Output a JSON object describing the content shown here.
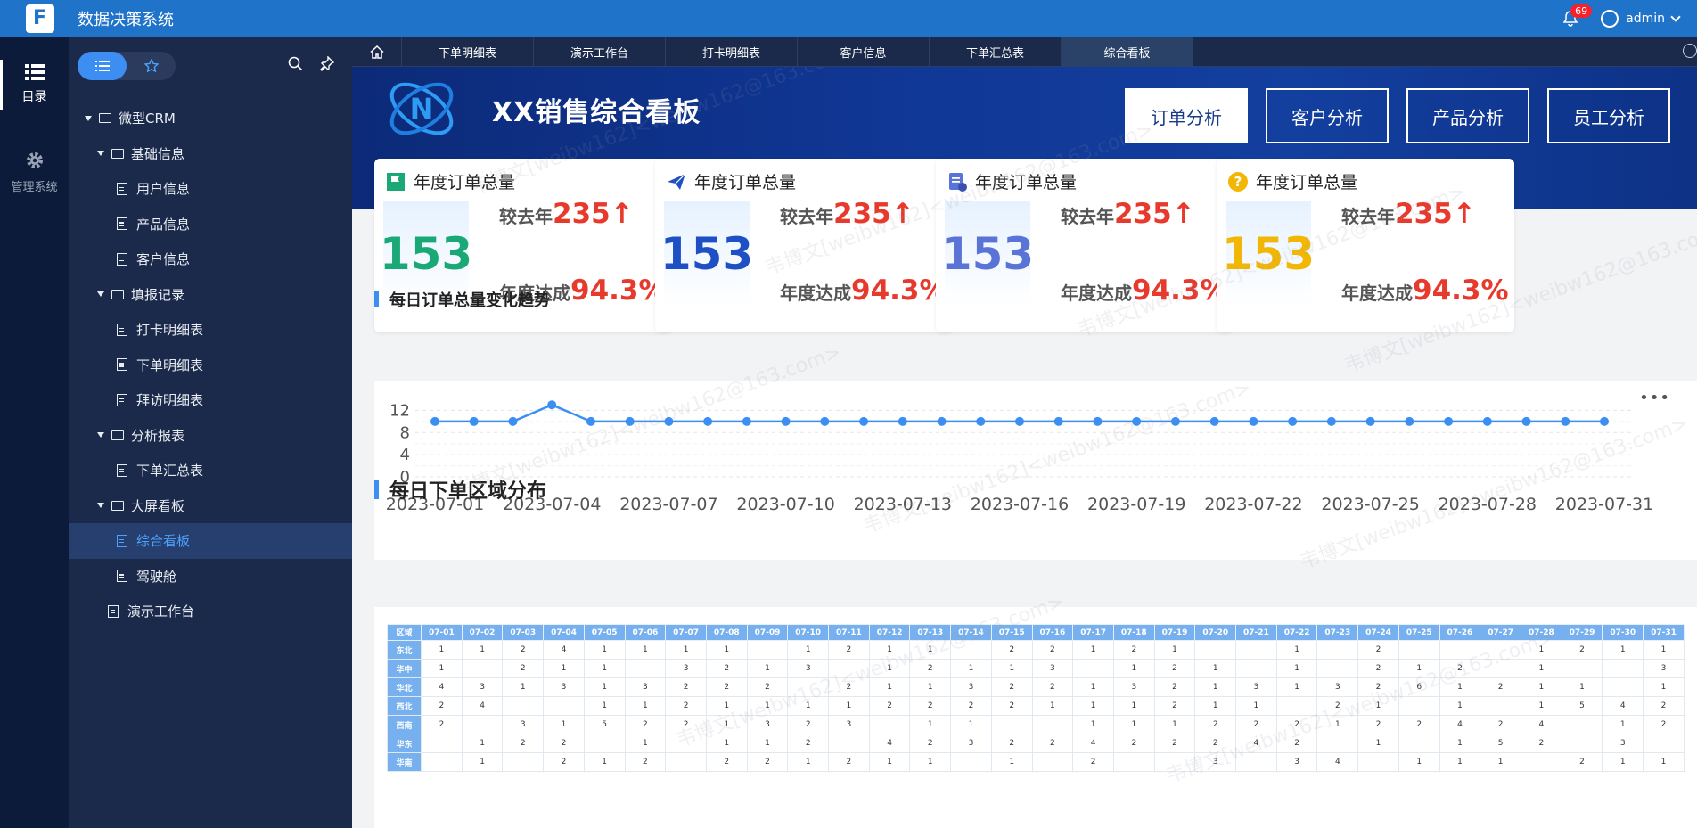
{
  "app": {
    "title": "数据决策系统",
    "logo_text": "F",
    "notifications": "69",
    "user": "admin"
  },
  "rail": [
    {
      "label": "目录",
      "icon": "list-icon"
    },
    {
      "label": "管理系统",
      "icon": "gear-icon"
    }
  ],
  "tree": [
    {
      "label": "微型CRM",
      "type": "folder",
      "level": 0
    },
    {
      "label": "基础信息",
      "type": "folder",
      "level": 1
    },
    {
      "label": "用户信息",
      "type": "doc",
      "level": 2
    },
    {
      "label": "产品信息",
      "type": "doc",
      "level": 2
    },
    {
      "label": "客户信息",
      "type": "doc",
      "level": 2
    },
    {
      "label": "填报记录",
      "type": "folder",
      "level": 1
    },
    {
      "label": "打卡明细表",
      "type": "doc",
      "level": 2
    },
    {
      "label": "下单明细表",
      "type": "doc",
      "level": 2
    },
    {
      "label": "拜访明细表",
      "type": "doc",
      "level": 2
    },
    {
      "label": "分析报表",
      "type": "folder",
      "level": 1
    },
    {
      "label": "下单汇总表",
      "type": "doc",
      "level": 2
    },
    {
      "label": "大屏看板",
      "type": "folder",
      "level": 1
    },
    {
      "label": "综合看板",
      "type": "doc",
      "level": 2,
      "selected": true
    },
    {
      "label": "驾驶舱",
      "type": "doc",
      "level": 2
    },
    {
      "label": "演示工作台",
      "type": "doc",
      "level": 1
    }
  ],
  "tabs": [
    "下单明细表",
    "演示工作台",
    "打卡明细表",
    "客户信息",
    "下单汇总表",
    "综合看板"
  ],
  "active_tab": "综合看板",
  "dashboard": {
    "title": "XX销售综合看板",
    "buttons": [
      "订单分析",
      "客户分析",
      "产品分析",
      "员工分析"
    ],
    "active_button": "订单分析",
    "cards": [
      {
        "title": "年度订单总量",
        "value": "153",
        "color": "#1aa876",
        "icon": "chart-flag-icon",
        "compare_label": "较去年",
        "compare_value": "235",
        "arrow": "↑",
        "rate_label": "年度达成",
        "rate_value": "94.3%"
      },
      {
        "title": "年度订单总量",
        "value": "153",
        "color": "#1e4fc4",
        "icon": "paper-plane-icon",
        "compare_label": "较去年",
        "compare_value": "235",
        "arrow": "↑",
        "rate_label": "年度达成",
        "rate_value": "94.3%"
      },
      {
        "title": "年度订单总量",
        "value": "153",
        "color": "#5a73d6",
        "icon": "document-badge-icon",
        "compare_label": "较去年",
        "compare_value": "235",
        "arrow": "↑",
        "rate_label": "年度达成",
        "rate_value": "94.3%"
      },
      {
        "title": "年度订单总量",
        "value": "153",
        "color": "#f2b705",
        "icon": "question-circle-icon",
        "compare_label": "较去年",
        "compare_value": "235",
        "arrow": "↑",
        "rate_label": "年度达成",
        "rate_value": "94.3%"
      }
    ],
    "trend_title": "每日订单总量变化趋势",
    "table_title": "每日下单区域分布",
    "table": {
      "corner": "区域",
      "columns": [
        "07-01",
        "07-02",
        "07-03",
        "07-04",
        "07-05",
        "07-06",
        "07-07",
        "07-08",
        "07-09",
        "07-10",
        "07-11",
        "07-12",
        "07-13",
        "07-14",
        "07-15",
        "07-16",
        "07-17",
        "07-18",
        "07-19",
        "07-20",
        "07-21",
        "07-22",
        "07-23",
        "07-24",
        "07-25",
        "07-26",
        "07-27",
        "07-28",
        "07-29",
        "07-30",
        "07-31"
      ],
      "rows": [
        {
          "region": "东北",
          "cells": [
            "1",
            "1",
            "2",
            "4",
            "1",
            "1",
            "1",
            "1",
            "",
            "1",
            "2",
            "1",
            "1",
            "",
            "2",
            "2",
            "1",
            "2",
            "1",
            "",
            "",
            "1",
            "",
            "2",
            "",
            "",
            "",
            "1",
            "2",
            "1",
            "1"
          ]
        },
        {
          "region": "华中",
          "cells": [
            "1",
            "",
            "2",
            "1",
            "1",
            "",
            "3",
            "2",
            "1",
            "3",
            "",
            "1",
            "2",
            "1",
            "1",
            "3",
            "",
            "1",
            "2",
            "1",
            "",
            "1",
            "",
            "2",
            "1",
            "2",
            "",
            "1",
            "",
            "",
            "3"
          ]
        },
        {
          "region": "华北",
          "cells": [
            "4",
            "3",
            "1",
            "3",
            "1",
            "3",
            "2",
            "2",
            "2",
            "",
            "2",
            "1",
            "1",
            "3",
            "2",
            "2",
            "1",
            "3",
            "2",
            "1",
            "3",
            "1",
            "3",
            "2",
            "6",
            "1",
            "2",
            "1",
            "1",
            "",
            "1"
          ]
        },
        {
          "region": "西北",
          "cells": [
            "2",
            "4",
            "",
            "",
            "1",
            "1",
            "2",
            "1",
            "1",
            "1",
            "1",
            "2",
            "2",
            "2",
            "2",
            "1",
            "1",
            "1",
            "2",
            "1",
            "1",
            "",
            "2",
            "1",
            "",
            "1",
            "",
            "1",
            "5",
            "4",
            "2"
          ]
        },
        {
          "region": "西南",
          "cells": [
            "2",
            "",
            "3",
            "1",
            "5",
            "2",
            "2",
            "1",
            "3",
            "2",
            "3",
            "",
            "1",
            "1",
            "",
            "",
            "1",
            "1",
            "1",
            "2",
            "2",
            "2",
            "1",
            "2",
            "2",
            "4",
            "2",
            "4",
            "",
            "1",
            "2"
          ]
        },
        {
          "region": "华东",
          "cells": [
            "",
            "1",
            "2",
            "2",
            "",
            "1",
            "",
            "1",
            "1",
            "2",
            "",
            "4",
            "2",
            "3",
            "2",
            "2",
            "4",
            "2",
            "2",
            "2",
            "4",
            "2",
            "",
            "1",
            "",
            "1",
            "5",
            "2",
            "",
            "3",
            ""
          ]
        },
        {
          "region": "华南",
          "cells": [
            "",
            "1",
            "",
            "2",
            "1",
            "2",
            "",
            "2",
            "2",
            "1",
            "2",
            "1",
            "1",
            "",
            "1",
            "",
            "2",
            "",
            "",
            "3",
            "",
            "3",
            "4",
            "",
            "1",
            "1",
            "1",
            "",
            "2",
            "1",
            "1"
          ]
        }
      ]
    },
    "more_label": "•••"
  },
  "chart_data": {
    "type": "line",
    "title": "每日订单总量变化趋势",
    "x": [
      "2023-07-01",
      "2023-07-02",
      "2023-07-03",
      "2023-07-04",
      "2023-07-05",
      "2023-07-06",
      "2023-07-07",
      "2023-07-08",
      "2023-07-09",
      "2023-07-10",
      "2023-07-11",
      "2023-07-12",
      "2023-07-13",
      "2023-07-14",
      "2023-07-15",
      "2023-07-16",
      "2023-07-17",
      "2023-07-18",
      "2023-07-19",
      "2023-07-20",
      "2023-07-21",
      "2023-07-22",
      "2023-07-23",
      "2023-07-24",
      "2023-07-25",
      "2023-07-26",
      "2023-07-27",
      "2023-07-28",
      "2023-07-29",
      "2023-07-30",
      "2023-07-31"
    ],
    "values": [
      10,
      10,
      10,
      13,
      10,
      10,
      10,
      10,
      10,
      10,
      10,
      10,
      10,
      10,
      10,
      10,
      10,
      10,
      10,
      10,
      10,
      10,
      10,
      10,
      10,
      10,
      10,
      10,
      10,
      10,
      10
    ],
    "xticks": [
      "2023-07-01",
      "2023-07-04",
      "2023-07-07",
      "2023-07-10",
      "2023-07-13",
      "2023-07-16",
      "2023-07-19",
      "2023-07-22",
      "2023-07-25",
      "2023-07-28",
      "2023-07-31"
    ],
    "yticks": [
      0,
      4,
      8,
      12
    ],
    "ylim": [
      0,
      14
    ],
    "color": "#3b8ff2",
    "grid": true
  }
}
